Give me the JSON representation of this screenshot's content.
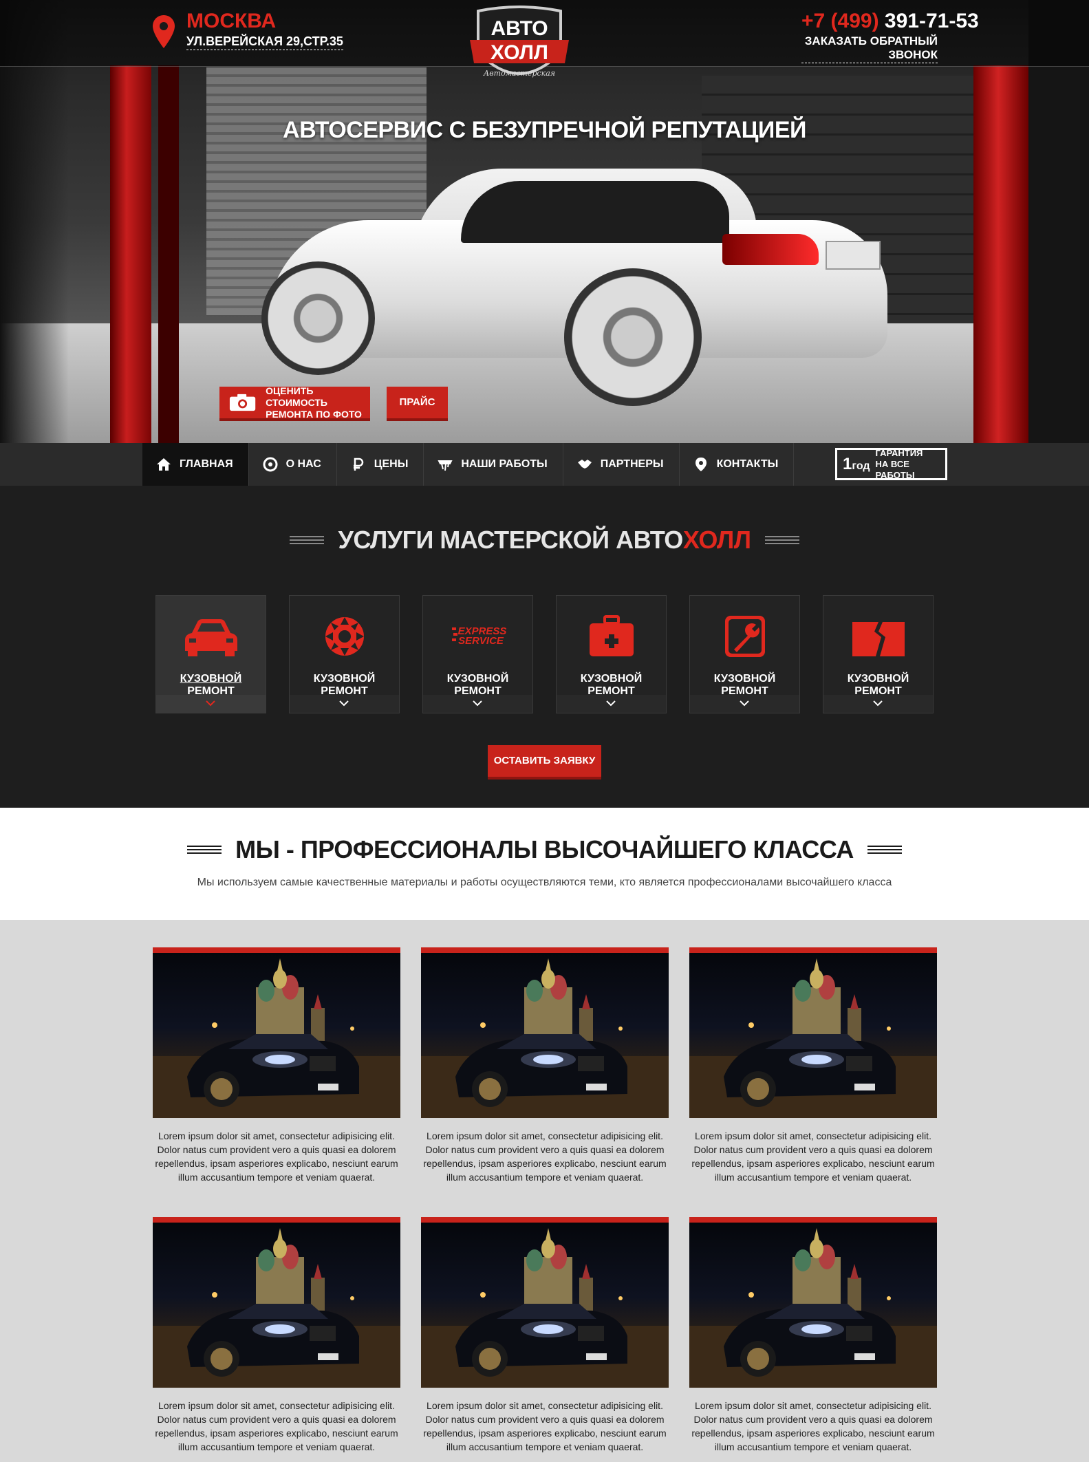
{
  "header": {
    "city": "МОСКВА",
    "address": "УЛ.ВЕРЕЙСКАЯ 29,СТР.35",
    "logo_top": "АВТО",
    "logo_bottom": "ХОЛЛ",
    "logo_sub": "Автомастерская",
    "phone_code": "+7 (499)",
    "phone_number": "391-71-53",
    "callback": "ЗАКАЗАТЬ ОБРАТНЫЙ ЗВОНОК"
  },
  "hero": {
    "tagline": "АВТОСЕРВИС С БЕЗУПРЕЧНОЙ РЕПУТАЦИЕЙ",
    "btn_photo_line1": "ОЦЕНИТЬ СТОИМОСТЬ",
    "btn_photo_line2": "РЕМОНТА ПО ФОТО",
    "btn_price": "ПРАЙС"
  },
  "nav": {
    "items": [
      {
        "label": "ГЛАВНАЯ",
        "icon": "home-icon"
      },
      {
        "label": "О НАС",
        "icon": "tire-icon"
      },
      {
        "label": "ЦЕНЫ",
        "icon": "ruble-icon"
      },
      {
        "label": "НАШИ РАБОТЫ",
        "icon": "tools-icon"
      },
      {
        "label": "ПАРТНЕРЫ",
        "icon": "handshake-icon"
      },
      {
        "label": "КОНТАКТЫ",
        "icon": "pin-icon"
      }
    ],
    "guarantee_num": "1",
    "guarantee_unit": "год",
    "guarantee_line1": "ГАРАНТИЯ",
    "guarantee_line2": "НА ВСЕ РАБОТЫ"
  },
  "services": {
    "title_part1": "УСЛУГИ МАСТЕРСКОЙ",
    "title_part2": "АВТО",
    "title_part3": "ХОЛЛ",
    "cards": [
      {
        "label": "КУЗОВНОЙ РЕМОНТ",
        "icon": "car-icon"
      },
      {
        "label": "КУЗОВНОЙ РЕМОНТ",
        "icon": "saw-blade-icon"
      },
      {
        "label": "КУЗОВНОЙ РЕМОНТ",
        "icon": "express-service-icon"
      },
      {
        "label": "КУЗОВНОЙ РЕМОНТ",
        "icon": "first-aid-icon"
      },
      {
        "label": "КУЗОВНОЙ РЕМОНТ",
        "icon": "wrench-icon"
      },
      {
        "label": "КУЗОВНОЙ РЕМОНТ",
        "icon": "broken-glass-icon"
      }
    ],
    "express_line1": "EXPRESS",
    "express_line2": "SERVICE",
    "button": "ОСТАВИТЬ ЗАЯВКУ"
  },
  "pros": {
    "title": "МЫ - ПРОФЕССИОНАЛЫ ВЫСОЧАЙШЕГО КЛАССА",
    "subtitle": "Мы используем самые качественные материалы и работы осуществляются теми, кто является профессионалами высочайшего класса"
  },
  "gallery": {
    "items": [
      {
        "caption": "Lorem ipsum dolor sit amet, consectetur adipisicing elit. Dolor natus cum provident vero a quis quasi ea dolorem repellendus, ipsam asperiores explicabo, nesciunt earum illum accusantium tempore et veniam quaerat."
      },
      {
        "caption": "Lorem ipsum dolor sit amet, consectetur adipisicing elit. Dolor natus cum provident vero a quis quasi ea dolorem repellendus, ipsam asperiores explicabo, nesciunt earum illum accusantium tempore et veniam quaerat."
      },
      {
        "caption": "Lorem ipsum dolor sit amet, consectetur adipisicing elit. Dolor natus cum provident vero a quis quasi ea dolorem repellendus, ipsam asperiores explicabo, nesciunt earum illum accusantium tempore et veniam quaerat."
      },
      {
        "caption": "Lorem ipsum dolor sit amet, consectetur adipisicing elit. Dolor natus cum provident vero a quis quasi ea dolorem repellendus, ipsam asperiores explicabo, nesciunt earum illum accusantium tempore et veniam quaerat."
      },
      {
        "caption": "Lorem ipsum dolor sit amet, consectetur adipisicing elit. Dolor natus cum provident vero a quis quasi ea dolorem repellendus, ipsam asperiores explicabo, nesciunt earum illum accusantium tempore et veniam quaerat."
      },
      {
        "caption": "Lorem ipsum dolor sit amet, consectetur adipisicing elit. Dolor natus cum provident vero a quis quasi ea dolorem repellendus, ipsam asperiores explicabo, nesciunt earum illum accusantium tempore et veniam quaerat."
      }
    ]
  },
  "colors": {
    "accent": "#c8231b",
    "dark": "#1e1e1e",
    "nav": "#2b2b2b"
  }
}
